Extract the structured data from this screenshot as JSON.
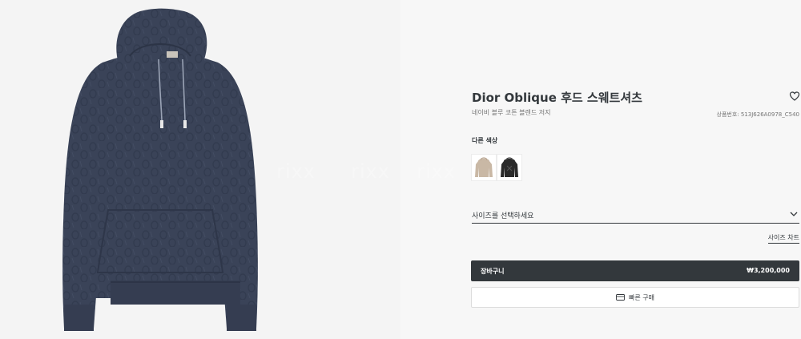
{
  "product": {
    "title": "Dior Oblique 후드 스웨트셔츠",
    "subtitle": "네이비 블루 코튼 블렌드 저지",
    "sku": "상품번호: 513J626A0978_C540"
  },
  "image": {
    "watermark": [
      "rixx",
      "rixx",
      "rixx"
    ],
    "garment_color": "#3a4358"
  },
  "colors": {
    "label": "다른 색상",
    "swatches": [
      {
        "name": "beige",
        "color": "#c9b8a5"
      },
      {
        "name": "black",
        "color": "#2a2a2a"
      }
    ]
  },
  "size": {
    "placeholder": "사이즈를 선택하세요",
    "chart_link": "사이즈 차트"
  },
  "cart": {
    "label": "장바구니",
    "price": "₩3,200,000"
  },
  "quick_buy": {
    "label": "빠른 구매"
  },
  "icons": {
    "wishlist": "heart-icon",
    "size_dropdown": "chevron-down-icon",
    "quick_buy": "credit-card-icon"
  },
  "theme": {
    "text": "#33383c",
    "muted": "#757575",
    "button_dark": "#33383c",
    "background": "#f7f7f7"
  }
}
